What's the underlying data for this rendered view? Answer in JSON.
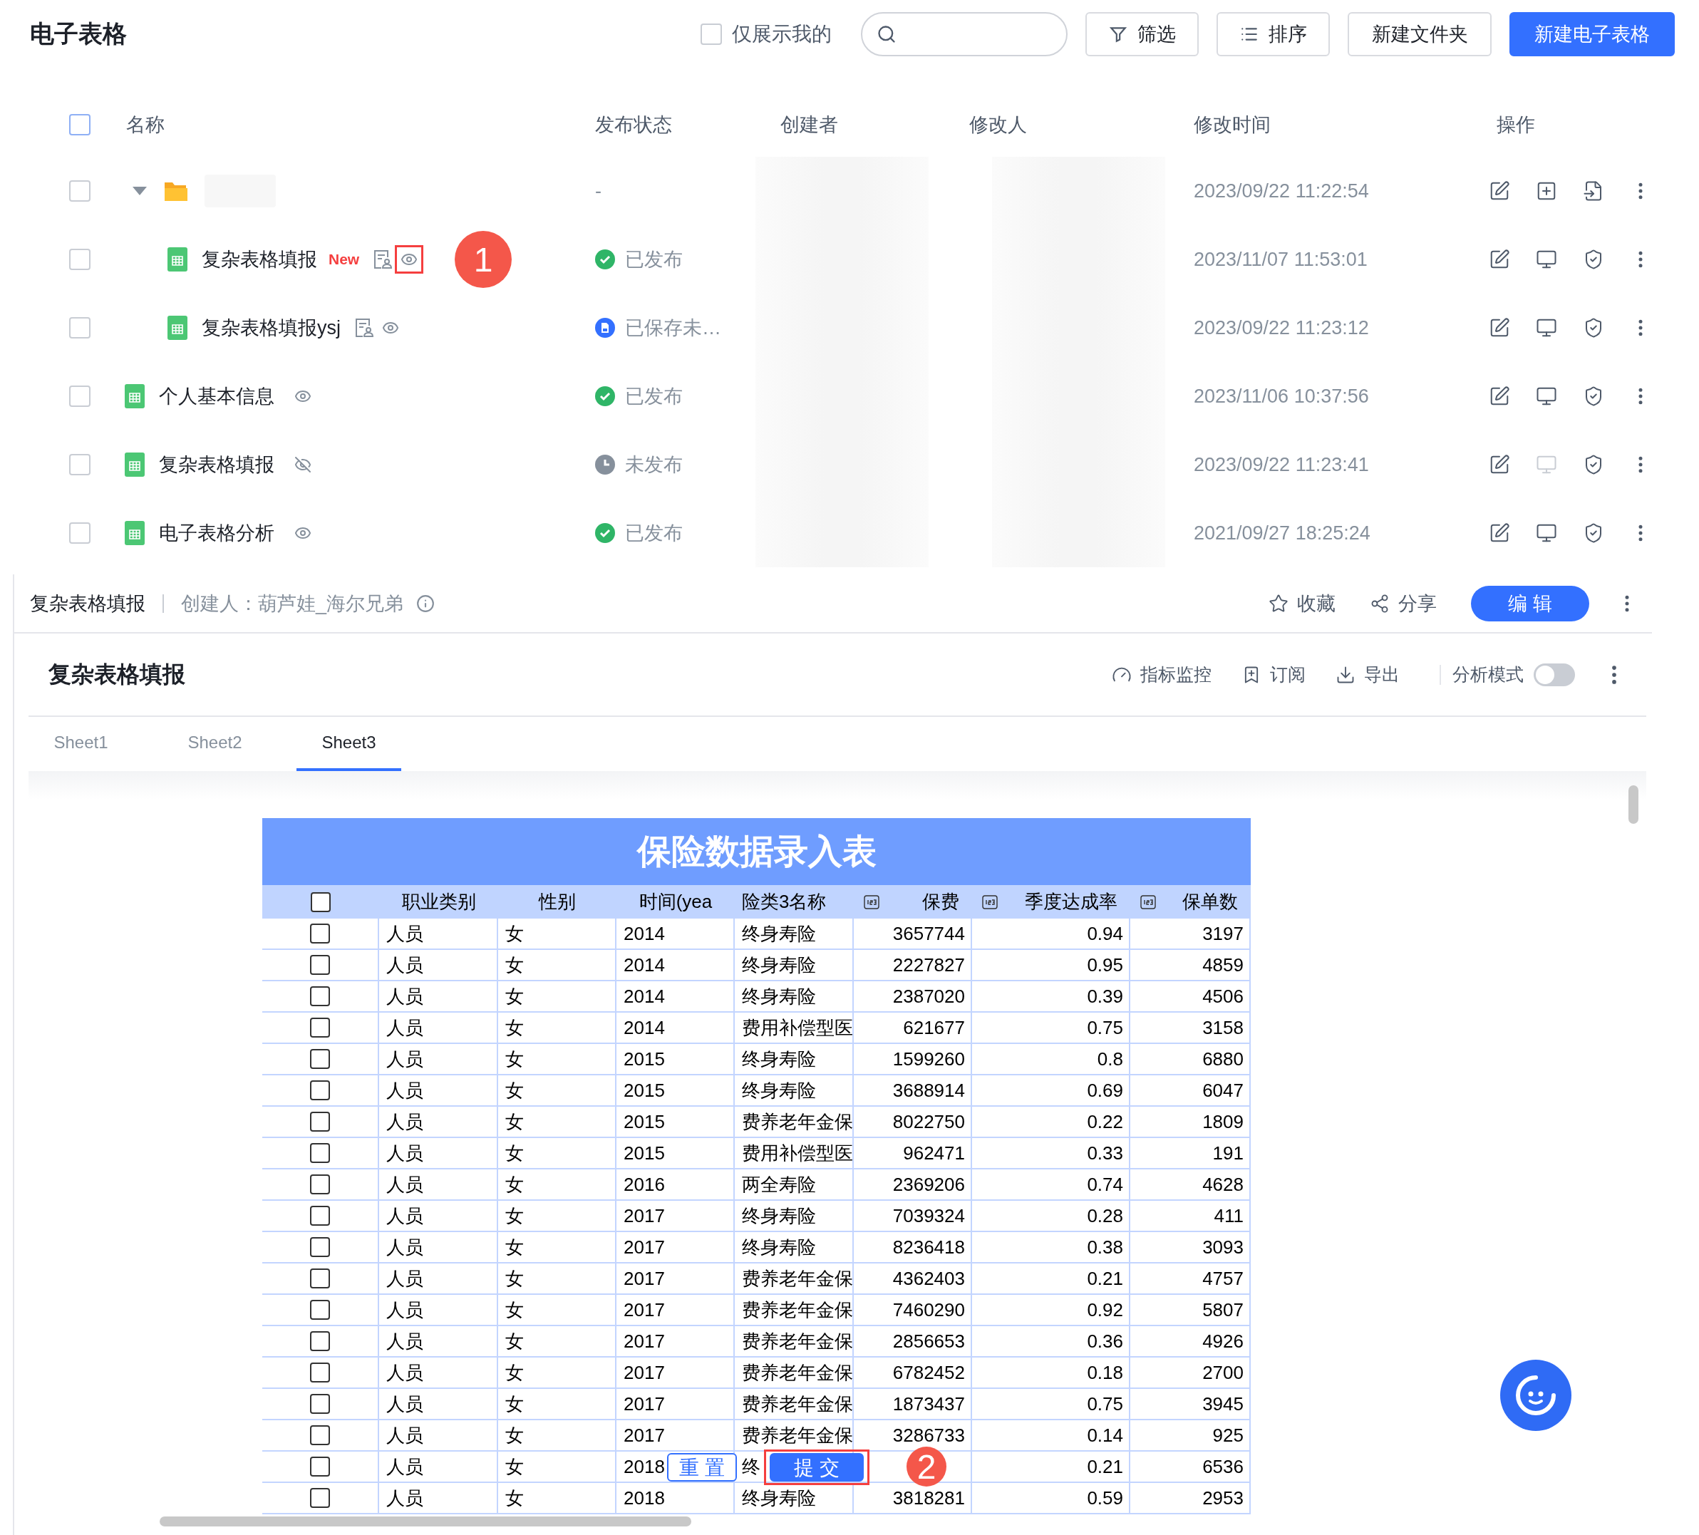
{
  "header": {
    "title": "电子表格",
    "only_mine": {
      "label": "仅展示我的",
      "checked": false
    },
    "buttons": [
      {
        "label": "筛选",
        "kind": "filter"
      },
      {
        "label": "排序",
        "kind": "sort"
      },
      {
        "label": "新建文件夹",
        "kind": "default"
      },
      {
        "label": "新建电子表格",
        "kind": "primary"
      }
    ]
  },
  "list": {
    "select_all": {
      "checked": false
    },
    "columns": [
      "名称",
      "发布状态",
      "创建者",
      "修改人",
      "修改时间",
      "操作"
    ],
    "rows": [
      {
        "kind": "folder",
        "checked": false,
        "expanded": true,
        "status": {
          "kind": "none",
          "label": "-"
        },
        "modified": "2023/09/22 11:22:54",
        "children": [
          {
            "kind": "sheet",
            "checked": false,
            "name": "复杂表格填报",
            "badge": "New",
            "fillable": true,
            "visible": true,
            "eye_highlighted": true,
            "callout": "1",
            "status": {
              "kind": "published",
              "label": "已发布"
            },
            "modified": "2023/11/07 11:53:01",
            "preview_enabled": true
          },
          {
            "kind": "sheet",
            "checked": false,
            "name": "复杂表格填报ysj",
            "fillable": true,
            "visible": true,
            "eye_highlighted": false,
            "status": {
              "kind": "saved",
              "label": "已保存未…"
            },
            "modified": "2023/09/22 11:23:12",
            "preview_enabled": true
          }
        ]
      },
      {
        "kind": "sheet",
        "checked": false,
        "name": "个人基本信息",
        "fillable": false,
        "visible": true,
        "eye_highlighted": false,
        "status": {
          "kind": "published",
          "label": "已发布"
        },
        "modified": "2023/11/06 10:37:56",
        "preview_enabled": true
      },
      {
        "kind": "sheet",
        "checked": false,
        "name": "复杂表格填报",
        "fillable": false,
        "visible": false,
        "eye_highlighted": false,
        "status": {
          "kind": "unpublished",
          "label": "未发布"
        },
        "modified": "2023/09/22 11:23:41",
        "preview_enabled": false
      },
      {
        "kind": "sheet",
        "checked": false,
        "name": "电子表格分析",
        "fillable": false,
        "visible": true,
        "eye_highlighted": false,
        "status": {
          "kind": "published",
          "label": "已发布"
        },
        "modified": "2021/09/27 18:25:24",
        "preview_enabled": true
      }
    ]
  },
  "detail": {
    "name": "复杂表格填报",
    "creator": "创建人：葫芦娃_海尔兄弟",
    "actions": [
      {
        "label": "收藏",
        "kind": "star"
      },
      {
        "label": "分享",
        "kind": "share"
      }
    ],
    "edit_button": "编 辑"
  },
  "report": {
    "title": "复杂表格填报",
    "tools": [
      {
        "label": "指标监控",
        "kind": "monitor"
      },
      {
        "label": "订阅",
        "kind": "subscribe"
      },
      {
        "label": "导出",
        "kind": "export"
      }
    ],
    "analysis_mode": {
      "label": "分析模式",
      "on": false
    },
    "tabs": [
      {
        "label": "Sheet1",
        "selected": false
      },
      {
        "label": "Sheet2",
        "selected": false
      },
      {
        "label": "Sheet3",
        "selected": true
      }
    ],
    "sheet": {
      "title": "保险数据录入表",
      "select_all": {
        "checked": false
      },
      "columns": [
        {
          "label": "职业类别",
          "numeric": false
        },
        {
          "label": "性别",
          "numeric": false
        },
        {
          "label": "时间(yea",
          "numeric": false
        },
        {
          "label": "险类3名称",
          "numeric": false
        },
        {
          "label": "保费",
          "numeric": true
        },
        {
          "label": "季度达成率",
          "numeric": true
        },
        {
          "label": "保单数",
          "numeric": true
        }
      ],
      "rows": [
        {
          "checked": false,
          "cells": [
            "人员",
            "女",
            "2014",
            "终身寿险",
            "3657744",
            "0.94",
            "3197"
          ]
        },
        {
          "checked": false,
          "cells": [
            "人员",
            "女",
            "2014",
            "终身寿险",
            "2227827",
            "0.95",
            "4859"
          ]
        },
        {
          "checked": false,
          "cells": [
            "人员",
            "女",
            "2014",
            "终身寿险",
            "2387020",
            "0.39",
            "4506"
          ]
        },
        {
          "checked": false,
          "cells": [
            "人员",
            "女",
            "2014",
            "费用补偿型医",
            "621677",
            "0.75",
            "3158"
          ]
        },
        {
          "checked": false,
          "cells": [
            "人员",
            "女",
            "2015",
            "终身寿险",
            "1599260",
            "0.8",
            "6880"
          ]
        },
        {
          "checked": false,
          "cells": [
            "人员",
            "女",
            "2015",
            "终身寿险",
            "3688914",
            "0.69",
            "6047"
          ]
        },
        {
          "checked": false,
          "cells": [
            "人员",
            "女",
            "2015",
            "费养老年金保",
            "8022750",
            "0.22",
            "1809"
          ]
        },
        {
          "checked": false,
          "cells": [
            "人员",
            "女",
            "2015",
            "费用补偿型医",
            "962471",
            "0.33",
            "191"
          ]
        },
        {
          "checked": false,
          "cells": [
            "人员",
            "女",
            "2016",
            "两全寿险",
            "2369206",
            "0.74",
            "4628"
          ]
        },
        {
          "checked": false,
          "cells": [
            "人员",
            "女",
            "2017",
            "终身寿险",
            "7039324",
            "0.28",
            "411"
          ]
        },
        {
          "checked": false,
          "cells": [
            "人员",
            "女",
            "2017",
            "终身寿险",
            "8236418",
            "0.38",
            "3093"
          ]
        },
        {
          "checked": false,
          "cells": [
            "人员",
            "女",
            "2017",
            "费养老年金保",
            "4362403",
            "0.21",
            "4757"
          ]
        },
        {
          "checked": false,
          "cells": [
            "人员",
            "女",
            "2017",
            "费养老年金保",
            "7460290",
            "0.92",
            "5807"
          ]
        },
        {
          "checked": false,
          "cells": [
            "人员",
            "女",
            "2017",
            "费养老年金保",
            "2856653",
            "0.36",
            "4926"
          ]
        },
        {
          "checked": false,
          "cells": [
            "人员",
            "女",
            "2017",
            "费养老年金保",
            "6782452",
            "0.18",
            "2700"
          ]
        },
        {
          "checked": false,
          "cells": [
            "人员",
            "女",
            "2017",
            "费养老年金保",
            "1873437",
            "0.75",
            "3945"
          ]
        },
        {
          "checked": false,
          "cells": [
            "人员",
            "女",
            "2017",
            "费养老年金保",
            "3286733",
            "0.14",
            "925"
          ]
        },
        {
          "checked": false,
          "cells": [
            "人员",
            "女",
            "2018",
            "终",
            null,
            "0.21",
            "6536"
          ]
        },
        {
          "checked": false,
          "cells": [
            "人员",
            "女",
            "2018",
            "终身寿险",
            "3818281",
            "0.59",
            "2953"
          ]
        }
      ],
      "reset_button": "重 置",
      "submit_button": "提 交",
      "submit_highlighted": true,
      "callout": "2"
    }
  }
}
